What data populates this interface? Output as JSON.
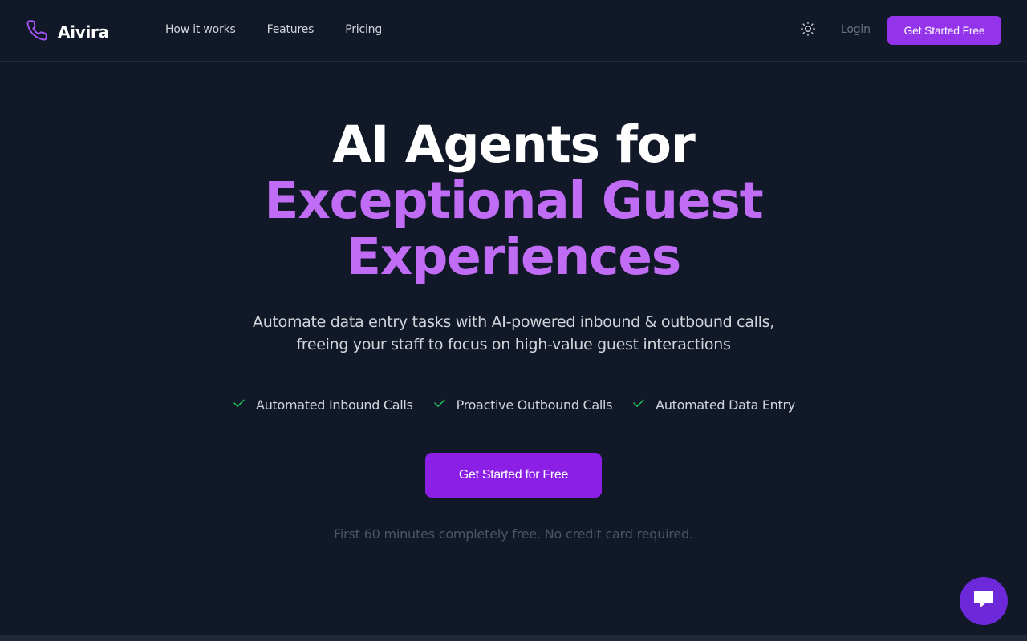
{
  "header": {
    "brand": "Aivira",
    "nav": [
      {
        "label": "How it works"
      },
      {
        "label": "Features"
      },
      {
        "label": "Pricing"
      }
    ],
    "theme_icon": "sun-icon",
    "login_label": "Login",
    "cta_label": "Get Started Free"
  },
  "hero": {
    "title_line1": "AI Agents for",
    "title_line2": "Exceptional Guest",
    "title_line3": "Experiences",
    "subtitle_line1": "Automate data entry tasks with AI-powered inbound & outbound calls,",
    "subtitle_line2": "freeing your staff to focus on high-value guest interactions",
    "features": [
      {
        "label": "Automated Inbound Calls",
        "icon": "check-icon"
      },
      {
        "label": "Proactive Outbound Calls",
        "icon": "check-icon"
      },
      {
        "label": "Automated Data Entry",
        "icon": "check-icon"
      }
    ],
    "cta_label": "Get Started for Free",
    "note": "First 60 minutes completely free. No credit card required."
  },
  "chat": {
    "icon": "chat-icon"
  },
  "colors": {
    "background": "#111827",
    "accent": "#9333ea",
    "accent_text": "#c06cf5",
    "check": "#22c55e"
  }
}
